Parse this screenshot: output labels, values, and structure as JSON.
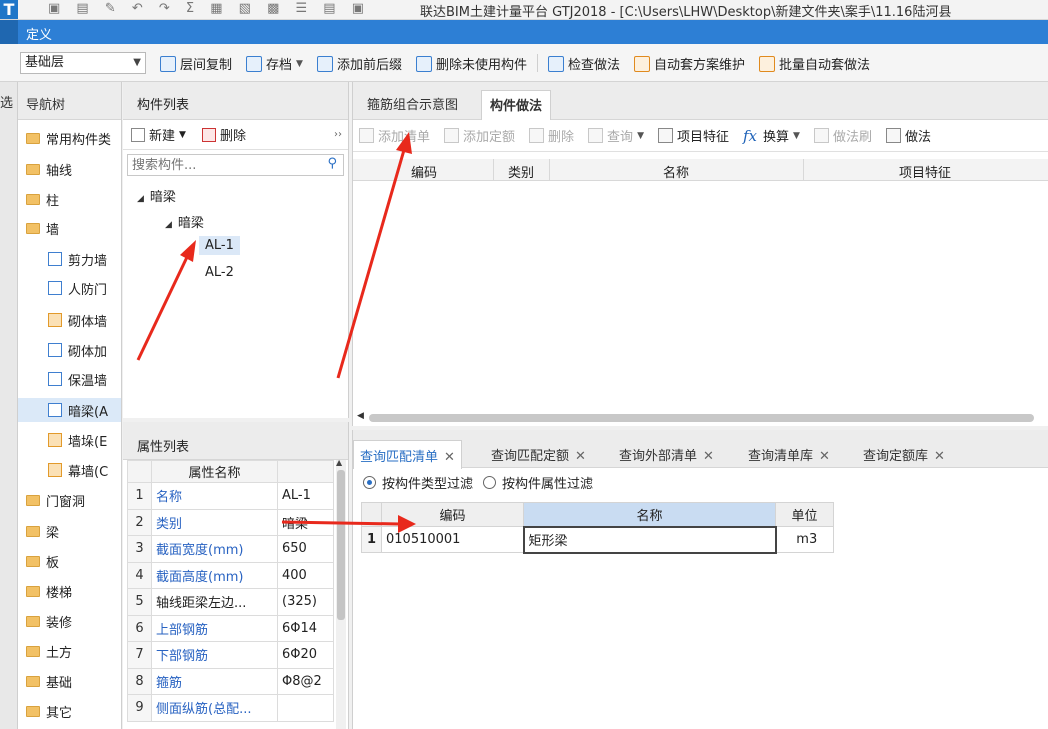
{
  "app": {
    "title": "联达BIM土建计量平台 GTJ2018 - [C:\\Users\\LHW\\Desktop\\新建文件夹\\案手\\11.16陆河县",
    "dialog_title": "定义"
  },
  "toolbar": {
    "layer": "基础层",
    "items": [
      "层间复制",
      "存档",
      "添加前后缀",
      "删除未使用构件",
      "检查做法",
      "自动套方案维护",
      "批量自动套做法"
    ]
  },
  "leftstrip": {
    "label": "选"
  },
  "nav": {
    "header": "导航树",
    "items": [
      "常用构件类",
      "轴线",
      "柱",
      "墙",
      "剪力墙",
      "人防门",
      "砌体墙",
      "砌体加",
      "保温墙",
      "暗梁(A",
      "墙垛(E",
      "幕墙(C",
      "门窗洞",
      "梁",
      "板",
      "楼梯",
      "装修",
      "土方",
      "基础",
      "其它"
    ]
  },
  "component_list": {
    "header": "构件列表",
    "new_label": "新建",
    "delete_label": "删除",
    "search_placeholder": "搜索构件...",
    "tree": {
      "root": "暗梁",
      "child": "暗梁",
      "items": [
        "AL-1",
        "AL-2"
      ]
    }
  },
  "properties": {
    "header": "属性列表",
    "col_name": "属性名称",
    "rows": [
      {
        "n": "1",
        "k": "名称",
        "v": "AL-1"
      },
      {
        "n": "2",
        "k": "类别",
        "v": "暗梁"
      },
      {
        "n": "3",
        "k": "截面宽度(mm)",
        "v": "650"
      },
      {
        "n": "4",
        "k": "截面高度(mm)",
        "v": "400"
      },
      {
        "n": "5",
        "k": "轴线距梁左边...",
        "v": "(325)"
      },
      {
        "n": "6",
        "k": "上部钢筋",
        "v": "6Φ14"
      },
      {
        "n": "7",
        "k": "下部钢筋",
        "v": "6Φ20"
      },
      {
        "n": "8",
        "k": "箍筋",
        "v": "Φ8@2"
      },
      {
        "n": "9",
        "k": "侧面纵筋(总配...",
        "v": ""
      }
    ]
  },
  "method_panel": {
    "tabs": [
      "箍筋组合示意图",
      "构件做法"
    ],
    "tools": [
      "添加清单",
      "添加定额",
      "删除",
      "查询",
      "项目特征",
      "换算",
      "做法刷",
      "做法"
    ],
    "columns": [
      "编码",
      "类别",
      "名称",
      "项目特征"
    ]
  },
  "query_panel": {
    "tabs": [
      "查询匹配清单",
      "查询匹配定额",
      "查询外部清单",
      "查询清单库",
      "查询定额库"
    ],
    "filters": [
      "按构件类型过滤",
      "按构件属性过滤"
    ],
    "columns": [
      "编码",
      "名称",
      "单位"
    ],
    "rows": [
      {
        "n": "1",
        "code": "010510001",
        "name": "矩形梁",
        "unit": "m3"
      }
    ]
  },
  "colors": {
    "accent": "#2d7fd5",
    "arrow": "#e8291c",
    "selection": "#dbe9f8"
  }
}
